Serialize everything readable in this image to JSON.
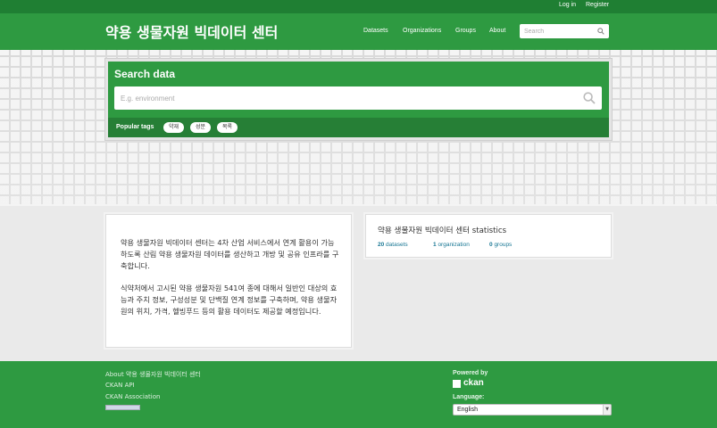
{
  "account": {
    "login": "Log in",
    "register": "Register"
  },
  "header": {
    "site_title": "약용 생물자원 빅데이터 센터",
    "nav": [
      "Datasets",
      "Organizations",
      "Groups",
      "About"
    ],
    "search_placeholder": "Search"
  },
  "search_module": {
    "heading": "Search data",
    "placeholder": "E.g. environment",
    "popular_tags_label": "Popular tags",
    "tags": [
      "약재",
      "성분",
      "목록"
    ]
  },
  "intro": {
    "paragraph1": "약용 생물자원 빅데이터 센터는 4차 산업 서비스에서 연계 활용이 가능하도록 산림 약용 생물자원 데이터를 생산하고 개방 및 공유 인프라를 구축합니다.",
    "paragraph2": "식약처에서 고시된 약용 생물자원 541여 종에 대해서 일반인 대상의 효능과 주치 정보, 구성성분 및 단백질 연계 정보를 구축하며, 약용 생물자원의 위치, 가격, 헬빙푸드 등의 활용 데이터도 제공할 예정입니다."
  },
  "stats": {
    "title": "약용 생물자원 빅데이터 센터 statistics",
    "items": [
      {
        "count": "20",
        "label": "datasets"
      },
      {
        "count": "1",
        "label": "organization"
      },
      {
        "count": "0",
        "label": "groups"
      }
    ]
  },
  "footer": {
    "links": [
      "About 약용 생물자원 빅데이터 센터",
      "CKAN API",
      "CKAN Association"
    ],
    "powered_by": "Powered by",
    "ckan_word": "ckan",
    "language_label": "Language:",
    "language_value": "English"
  },
  "colors": {
    "primary_green": "#2e9a41",
    "dark_green": "#1f7f33",
    "link_blue": "#187794"
  }
}
